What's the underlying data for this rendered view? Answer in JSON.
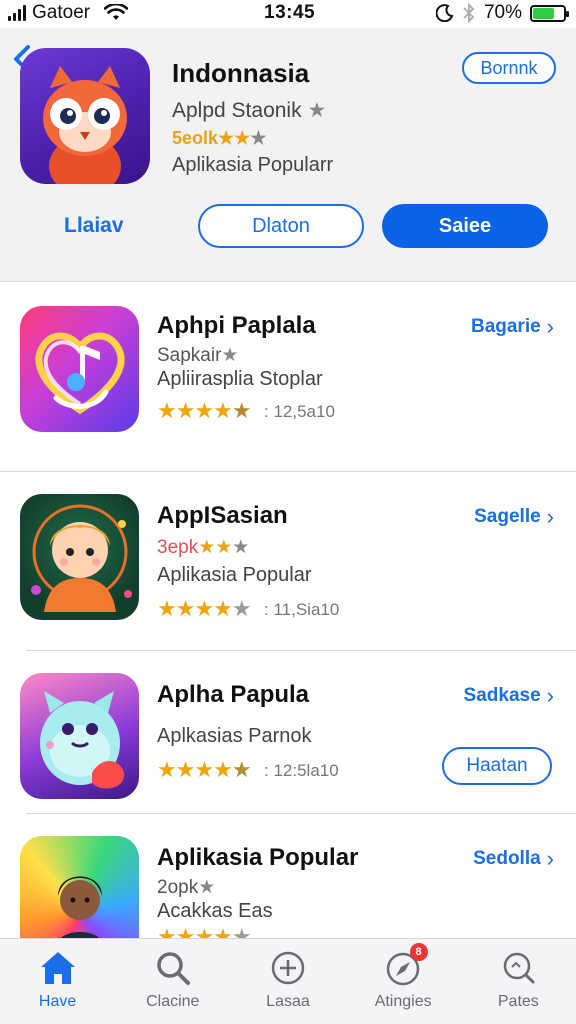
{
  "status_bar": {
    "carrier": "Gatoer",
    "time": "13:45",
    "battery": "70%",
    "battery_level": 0.7
  },
  "header": {
    "title": "Indonnasia",
    "subtitle": "Aplpd Staonik",
    "rating": "5eolk",
    "category": "Aplikasia Popularr",
    "pill_button": "Bornnk",
    "link_button": "Llaiav",
    "outline_button": "Dlaton",
    "primary_button": "Saiee"
  },
  "apps": [
    {
      "name": "Aphpi Paplala",
      "sub": "Sapkair",
      "desc": "Apliirasplia Stoplar",
      "count": "12,5a10",
      "link": "Bagarie",
      "rating": 4.5
    },
    {
      "name": "AppISasian",
      "sub": "3epk",
      "desc": "Aplikasia Popular",
      "count": "11,Sia10",
      "link": "Sagelle",
      "rating": 4
    },
    {
      "name": "Aplha Papula",
      "sub": "",
      "desc": "Aplkasias Parnok",
      "count": "12:5la10",
      "link": "Sadkase",
      "rating": 4.5,
      "button": "Haatan"
    },
    {
      "name": "Aplikasia Popular",
      "sub": "2opk",
      "desc": "Acakkas Eas",
      "count": "",
      "link": "Sedolla",
      "rating": 4
    }
  ],
  "tabs": [
    {
      "label": "Have",
      "icon": "home-icon"
    },
    {
      "label": "Clacine",
      "icon": "search-icon"
    },
    {
      "label": "Lasaa",
      "icon": "plus-circle-icon"
    },
    {
      "label": "Atingies",
      "icon": "compass-icon",
      "badge": "8"
    },
    {
      "label": "Pates",
      "icon": "magnifier-icon"
    }
  ],
  "colors": {
    "accent": "#1a6ee8",
    "primary_button": "#0a63e6",
    "star": "#f0a50a"
  }
}
